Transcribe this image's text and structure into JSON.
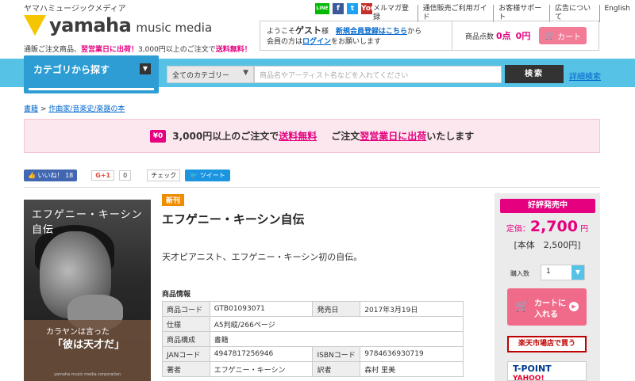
{
  "header": {
    "tagline": "ヤマハミュージックメディア",
    "logo_main": "yamaha",
    "logo_sub": "music media",
    "promo_prefix": "通販ご注文商品、",
    "promo_highlight1": "翌営業日に出荷！",
    "promo_middle": "3,000円以上のご注文で",
    "promo_highlight2": "送料無料！",
    "social": [
      "LINE",
      "f",
      "t",
      "You"
    ],
    "toplinks": [
      "メルマガ登録",
      "通信販売ご利用ガイド",
      "お客様サポート",
      "広告について",
      "English"
    ],
    "welcome_pre": "ようこそ",
    "welcome_guest": "ゲスト",
    "welcome_sama": "様",
    "signup_link": "新規会員登録はこちら",
    "signup_suffix": "から",
    "member_pre": "会員の方は",
    "login_link": "ログイン",
    "member_suffix": "をお願いします",
    "cart_points_label": "商品点数",
    "cart_points": "0点",
    "cart_total": "0円",
    "cart_button": "カート"
  },
  "search": {
    "category_button": "カテゴリから探す",
    "category_select": "全てのカテゴリー",
    "placeholder": "商品名やアーティスト名などを入れてください",
    "search_button": "検索",
    "advanced_link": "詳細検索"
  },
  "breadcrumb": {
    "root": "書籍",
    "separator": " > ",
    "current": "作曲家/音楽史/楽器の本"
  },
  "banner": {
    "truck_label": "¥0",
    "text1": "3,000円以上のご注文で",
    "highlight1": "送料無料",
    "text2": "ご注文",
    "highlight2": "翌営業日に出荷",
    "text3": "いたします"
  },
  "share": {
    "like": "いいね！",
    "like_count": "18",
    "gplus": "G+1",
    "gplus_count": "0",
    "check": "チェック",
    "tweet": "ツイート"
  },
  "cover": {
    "title": "エフゲニー・キーシン自伝",
    "quote1": "カラヤンは言った",
    "quote2": "「彼は天才だ」",
    "publisher": "yamaha music media corporation"
  },
  "product": {
    "badge": "新刊",
    "title": "エフゲニー・キーシン自伝",
    "description": "天才ピアニスト、エフゲニー・キーシン初の自伝。",
    "info_heading": "商品情報",
    "rows": [
      {
        "k1": "商品コード",
        "v1": "GTB01093071",
        "k2": "発売日",
        "v2": "2017年3月19日"
      },
      {
        "k1": "仕様",
        "v1": "A5判縦/266ページ",
        "k2": "",
        "v2": ""
      },
      {
        "k1": "商品構成",
        "v1": "書籍",
        "k2": "",
        "v2": ""
      },
      {
        "k1": "JANコード",
        "v1": "4947817256946",
        "k2": "ISBNコード",
        "v2": "9784636930719"
      },
      {
        "k1": "著者",
        "v1": "エフゲニー・キーシン",
        "k2": "訳者",
        "v2": "森村 里美"
      }
    ]
  },
  "pricebox": {
    "status": "好評発売中",
    "price_label": "定価：",
    "price": "2,700",
    "price_unit": "円",
    "base": "[本体　2,500円]",
    "qty_label": "購入数",
    "qty_value": "1",
    "cart_line1": "カートに",
    "cart_line2": "入れる",
    "rakuten": "楽天市場店で買う",
    "tpoint": "T-POINT",
    "yahoo": "YAHOO!"
  },
  "colors": {
    "accent_pink": "#e4007f",
    "search_blue": "#56c2e6",
    "logo_yellow": "#f5c600"
  }
}
